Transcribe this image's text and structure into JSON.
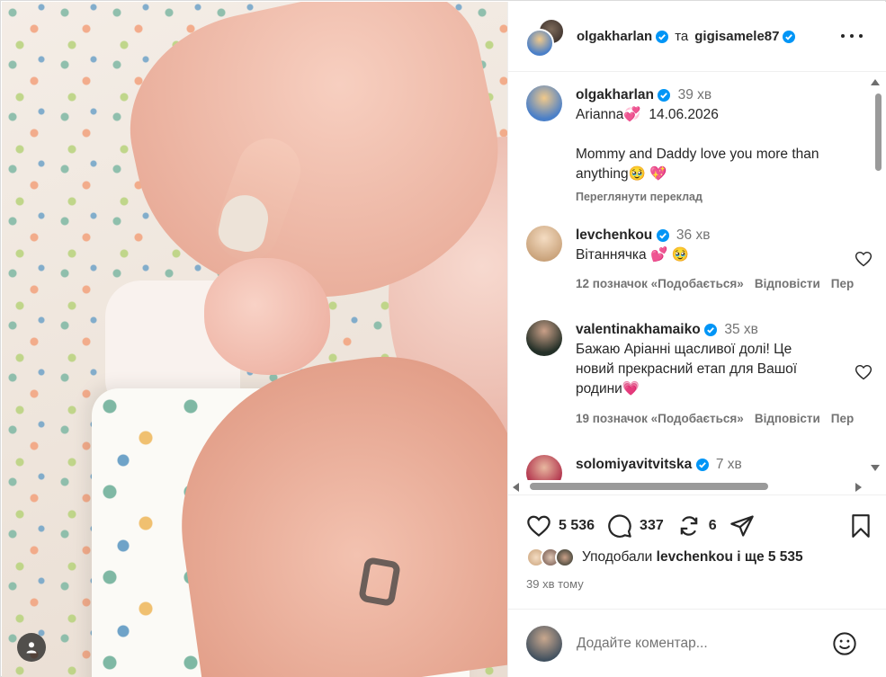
{
  "post": {
    "author": "olgakharlan",
    "coauthor_joiner": "та",
    "coauthor": "gigisamele87"
  },
  "caption": {
    "user": "olgakharlan",
    "time": "39 хв",
    "line1": "Arianna💞  14.06.2026",
    "line2": "Mommy and Daddy love you more than anything🥹 💖",
    "translate": "Переглянути переклад"
  },
  "comments": [
    {
      "user": "levchenkou",
      "time": "36 хв",
      "text": "Вітаннячка 💕 🥹",
      "likes": "12 позначок «Подобається»",
      "reply": "Відповісти",
      "overflow": "Пер"
    },
    {
      "user": "valentinakhamaiko",
      "time": "35 хв",
      "text": "Бажаю Аріанні щасливої долі! Це новий прекрасний етап для Вашої родини💗",
      "likes": "19 позначок «Подобається»",
      "reply": "Відповісти",
      "overflow": "Пер"
    },
    {
      "user": "solomiyavitvitska",
      "time": "7 хв"
    }
  ],
  "actions": {
    "likes_count": "5 536",
    "comments_count": "337",
    "reposts_count": "6"
  },
  "liked_by": {
    "prefix": "Уподобали",
    "user": "levchenkou",
    "suffix": "і ще 5 535"
  },
  "time_ago": "39 хв тому",
  "composer": {
    "placeholder": "Додайте коментар..."
  },
  "icons": {
    "verified": "verified-badge-icon",
    "like": "heart-icon",
    "comment": "comment-bubble-icon",
    "repost": "repost-icon",
    "share": "paper-plane-icon",
    "save": "bookmark-icon",
    "more": "more-horizontal-icon",
    "emoji": "smiley-icon",
    "user_tag": "person-icon"
  },
  "colors": {
    "verified": "#0095f6",
    "text": "#262626",
    "muted": "#737373",
    "border": "#dbdbdb"
  }
}
